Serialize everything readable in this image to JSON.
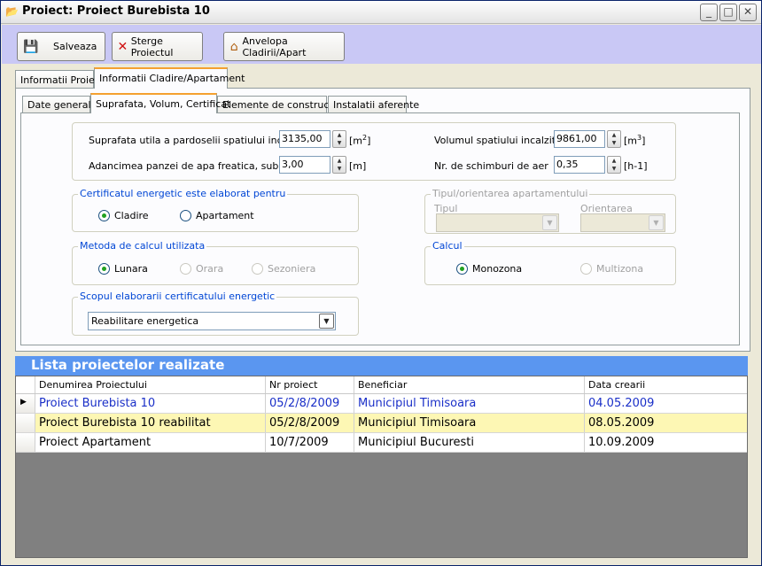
{
  "window": {
    "title": "Proiect: Proiect Burebista 10",
    "controls": {
      "minimize": "_",
      "maximize": "□",
      "close": "✕"
    }
  },
  "toolbar": {
    "save_label": "Salveaza",
    "delete_label": "Sterge Proiectul",
    "envelope_label": "Anvelopa Cladirii/Apart"
  },
  "tabs_main": [
    "Informatii Proiect",
    "Informatii Cladire/Apartament"
  ],
  "tabs_sub": [
    "Date generale",
    "Suprafata, Volum, Certificat",
    "Elemente de constructie",
    "Instalatii aferente"
  ],
  "dimensions": {
    "area_label": "Suprafata utila a pardoselii spatiului incalzit",
    "area_value": "3135,00",
    "area_unit": "[m",
    "area_unit_sup": "2",
    "area_unit_end": "]",
    "depth_label": "Adancimea panzei de apa freatica, sub CTS",
    "depth_value": "3,00",
    "depth_unit": "[m]",
    "volume_label": "Volumul spatiului incalzit",
    "volume_value": "9861,00",
    "volume_unit": "[m",
    "volume_unit_sup": "3",
    "volume_unit_end": "]",
    "air_label": "Nr. de schimburi de aer",
    "air_value": "0,35",
    "air_unit": "[h-1]"
  },
  "certificate": {
    "group_label": "Certificatul energetic este elaborat pentru",
    "options": [
      "Cladire",
      "Apartament"
    ],
    "selected": "Cladire"
  },
  "apartment": {
    "group_label": "Tipul/orientarea apartamentului",
    "type_label": "Tipul",
    "orientation_label": "Orientarea"
  },
  "method": {
    "group_label": "Metoda de calcul utilizata",
    "options": [
      "Lunara",
      "Orara",
      "Sezoniera"
    ],
    "selected": "Lunara"
  },
  "calc": {
    "group_label": "Calcul",
    "options": [
      "Monozona",
      "Multizona"
    ],
    "selected": "Monozona"
  },
  "purpose": {
    "group_label": "Scopul elaborarii certificatului energetic",
    "value": "Reabilitare energetica"
  },
  "projects": {
    "title": "Lista proiectelor realizate",
    "columns": [
      "Denumirea Proiectului",
      "Nr proiect",
      "Beneficiar",
      "Data crearii"
    ],
    "rows": [
      {
        "name": "Proiect Burebista 10",
        "nr": "05/2/8/2009",
        "beneficiary": "Municipiul Timisoara",
        "date": "04.05.2009"
      },
      {
        "name": "Proiect Burebista 10 reabilitat",
        "nr": "05/2/8/2009",
        "beneficiary": "Municipiul Timisoara",
        "date": "08.05.2009"
      },
      {
        "name": "Proiect Apartament",
        "nr": "10/7/2009",
        "beneficiary": "Municipiul Bucuresti",
        "date": "10.09.2009"
      }
    ]
  },
  "colors": {
    "toolbar_bg": "#c9c8f5",
    "list_header": "#5a96f0",
    "selected_row_text": "#1a2fc8",
    "highlight_row": "#fdf7b4",
    "group_label": "#0046d5"
  }
}
